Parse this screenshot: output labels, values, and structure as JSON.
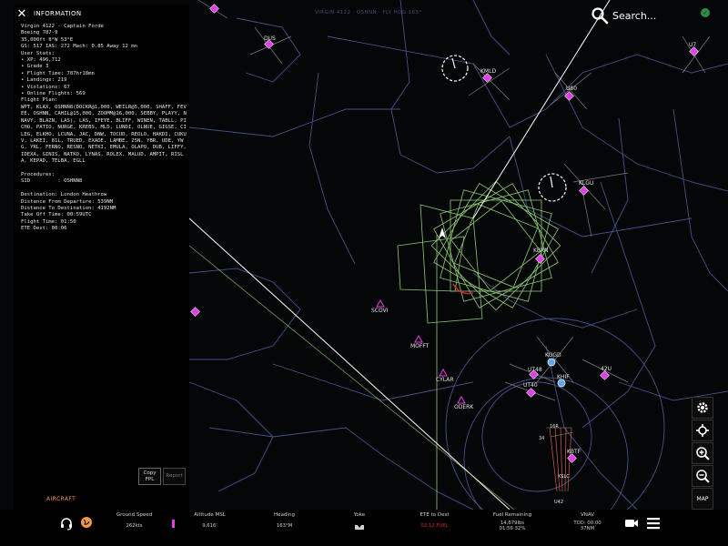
{
  "header": {
    "close_symbol": "✕",
    "panel_title": "INFORMATION",
    "flight_id": "VIRGIN 4122 · OSHNN · FLY HDG 163°",
    "search_label": "Search...",
    "gps_status": "✓"
  },
  "info": {
    "text": "Virgin 4122 - Captain Forde\nBoeing 787-9\n35,000ft 8°W 53°E\nGS: 517 IAS: 272 Mach: 0.85 Away 12 mn\nUser Stats:\n• XP: 496,712\n• Grade 3\n• Flight Time: 787hr18mn\n• Landings: 219\n• Violations: 67\n• Online Flights: 569\nFlight Plan:\nWPT, KLAX, OSHNN8(DOCKR@1,000, WEILR@5,000, SHAFF, FEVEE, OSHNN, CAHIL@15,000, ZOOMM@16,000, SEBBY, PLAYY, NNAVY, BLAZN, LAS), LAS, IFEYE, BLIFF, WINEN, TABLL, PICHO, PATIO, NURGE, KREBS, MLD, LUNDI, OLNUE, GIGSE, CILEG, ELKHO, LCUNA, JAC, DNW, TOCUD, REOLO, HAKDI, CUKUV, LAKEI, 81L, TRUED, EXADE, LAMBE, 25N, YBR, UDE, YWG, YRL, FERNO, RESNO, NETKI, EMULA, OLAPO, DUB, LIFFY, IDEXA, GINIS, NATKO, LYNAS, ROLEX, MALUD, AMPIT, RISLA, KEPAD, TELBA, EGLL\n\nProcedures:\nSID         : OSHNN8\n\nDestination: London Heathrow\nDistance From Departure: 539NM\nDistance To Destination: 4192NM\nTake Off Time: 00:59UTC\nFlight Time: 01:50\nETE Dest: 08:06",
    "copy_fpl": "Copy FPL",
    "report": "Report",
    "aircraft_tab": "AIRCRAFT"
  },
  "map": {
    "waypoints": [
      "DUS",
      "KMLD",
      "U7",
      "U80",
      "KLGU",
      "KBXN",
      "KOGD",
      "UT48",
      "KHIF",
      "42U",
      "UT40",
      "KBTF",
      "SCOVI",
      "MOFFT",
      "CYLAR",
      "ODERK",
      "KSLC",
      "U42"
    ],
    "bottom_labels": [
      "16R",
      "34"
    ]
  },
  "bottom": {
    "ground_speed_label": "Ground Speed",
    "ground_speed": "262kts",
    "altitude_label": "Altitude MSL",
    "altitude": "9,616'",
    "heading_label": "Heading",
    "heading": "163°M",
    "yoke_label": "Yoke",
    "ete_label": "ETE to Dest",
    "ete": "02:12 FUEL",
    "fuel_label": "Fuel Remaining",
    "fuel_1": "14,679lbs",
    "fuel_2": "01:56 32%",
    "vnav_label": "VNAV",
    "vnav_1": "TOD: 00:00",
    "vnav_2": "37NM"
  },
  "side": {
    "map_label": "MAP"
  },
  "colors": {
    "route_green": "#9be27f",
    "airport_magenta": "#e040e6",
    "airspace_blue": "#4b5a95",
    "fuel_red": "#e0262a",
    "aircraft_orange": "#f2994a"
  }
}
